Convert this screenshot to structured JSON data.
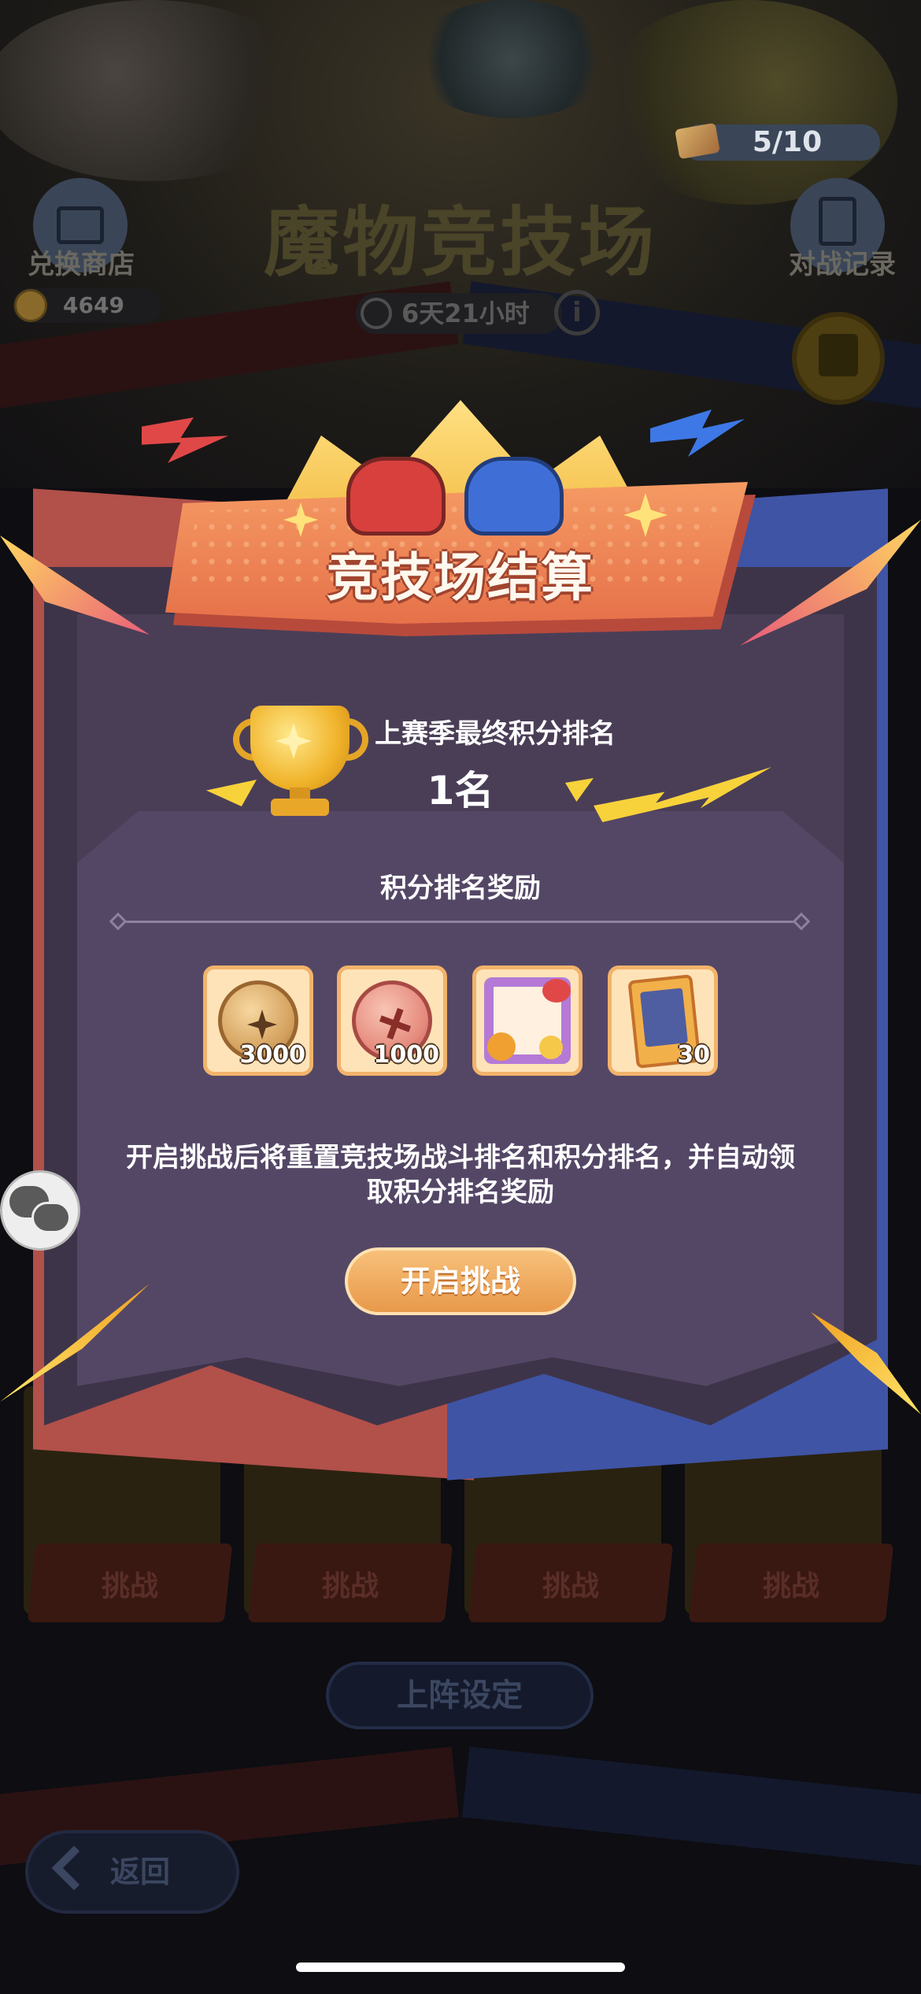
{
  "ticket": {
    "count": "5/10"
  },
  "shop": {
    "label": "兑换商店",
    "coins": "4649"
  },
  "page_title": "魔物竞技场",
  "timer": {
    "text": "6天21小时",
    "info_icon": "i"
  },
  "record": {
    "label": "对战记录"
  },
  "opponents": [
    {
      "challenge_label": "挑战"
    },
    {
      "challenge_label": "挑战"
    },
    {
      "challenge_label": "挑战"
    },
    {
      "challenge_label": "挑战"
    }
  ],
  "lineup_label": "上阵设定",
  "back_label": "返回",
  "modal": {
    "title": "竞技场结算",
    "rank_caption": "上赛季最终积分排名",
    "rank_value": "1名",
    "reward_title": "积分排名奖励",
    "rewards": [
      {
        "icon": "gold-coin-icon",
        "count": "3000"
      },
      {
        "icon": "pink-coin-icon",
        "count": "1000"
      },
      {
        "icon": "avatar-frame-icon",
        "count": ""
      },
      {
        "icon": "card-icon",
        "count": "30"
      }
    ],
    "notice": "开启挑战后将重置竞技场战斗排名和积分排名，并自动领取积分排名奖励",
    "start_button": "开启挑战"
  },
  "colors": {
    "modal_bg": "#4a3e57",
    "banner": "#e6714a",
    "button": "#e8994a",
    "red_team": "#b2504a",
    "blue_team": "#3f54a5"
  }
}
